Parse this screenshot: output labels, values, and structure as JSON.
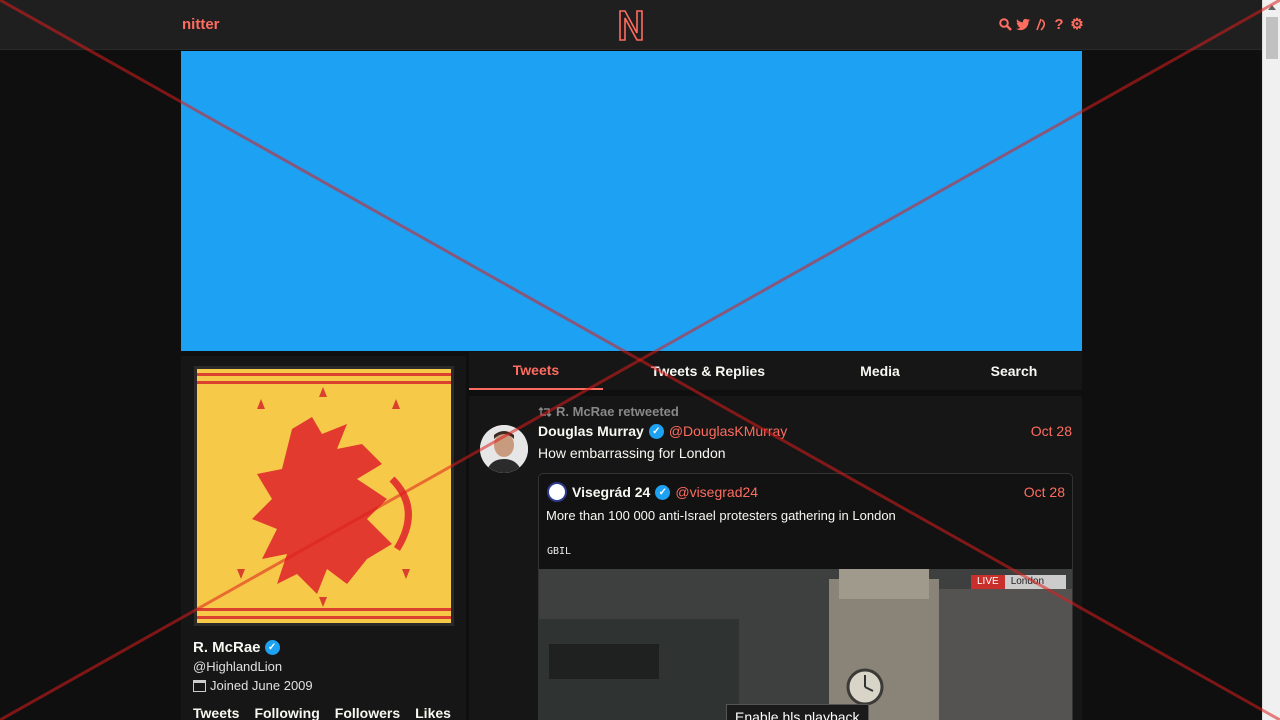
{
  "navbar": {
    "brand": "nitter",
    "icons": [
      "search-icon",
      "twitter-icon",
      "rss-icon",
      "help-icon",
      "gear-icon"
    ]
  },
  "colors": {
    "accent": "#ff6c60",
    "banner": "#1da1f2",
    "background": "#0f0f0f",
    "panel": "#161616"
  },
  "profile": {
    "name": "R. McRae",
    "handle": "@HighlandLion",
    "joined": "Joined June 2009",
    "stats": [
      "Tweets",
      "Following",
      "Followers",
      "Likes"
    ]
  },
  "tabs": [
    "Tweets",
    "Tweets & Replies",
    "Media",
    "Search"
  ],
  "tweet": {
    "retweet_label": "R. McRae retweeted",
    "author_name": "Douglas Murray",
    "author_handle": "@DouglasKMurray",
    "date": "Oct 28",
    "text": "How embarrassing for London",
    "quote": {
      "author_name": "Visegrád 24",
      "author_handle": "@visegrad24",
      "date": "Oct 28",
      "text": "More than 100 000 anti-Israel protesters gathering in London",
      "overlay_text": "GBIL",
      "live_label": "LIVE",
      "live_location": "London",
      "hls_button": "Enable hls playback"
    }
  }
}
